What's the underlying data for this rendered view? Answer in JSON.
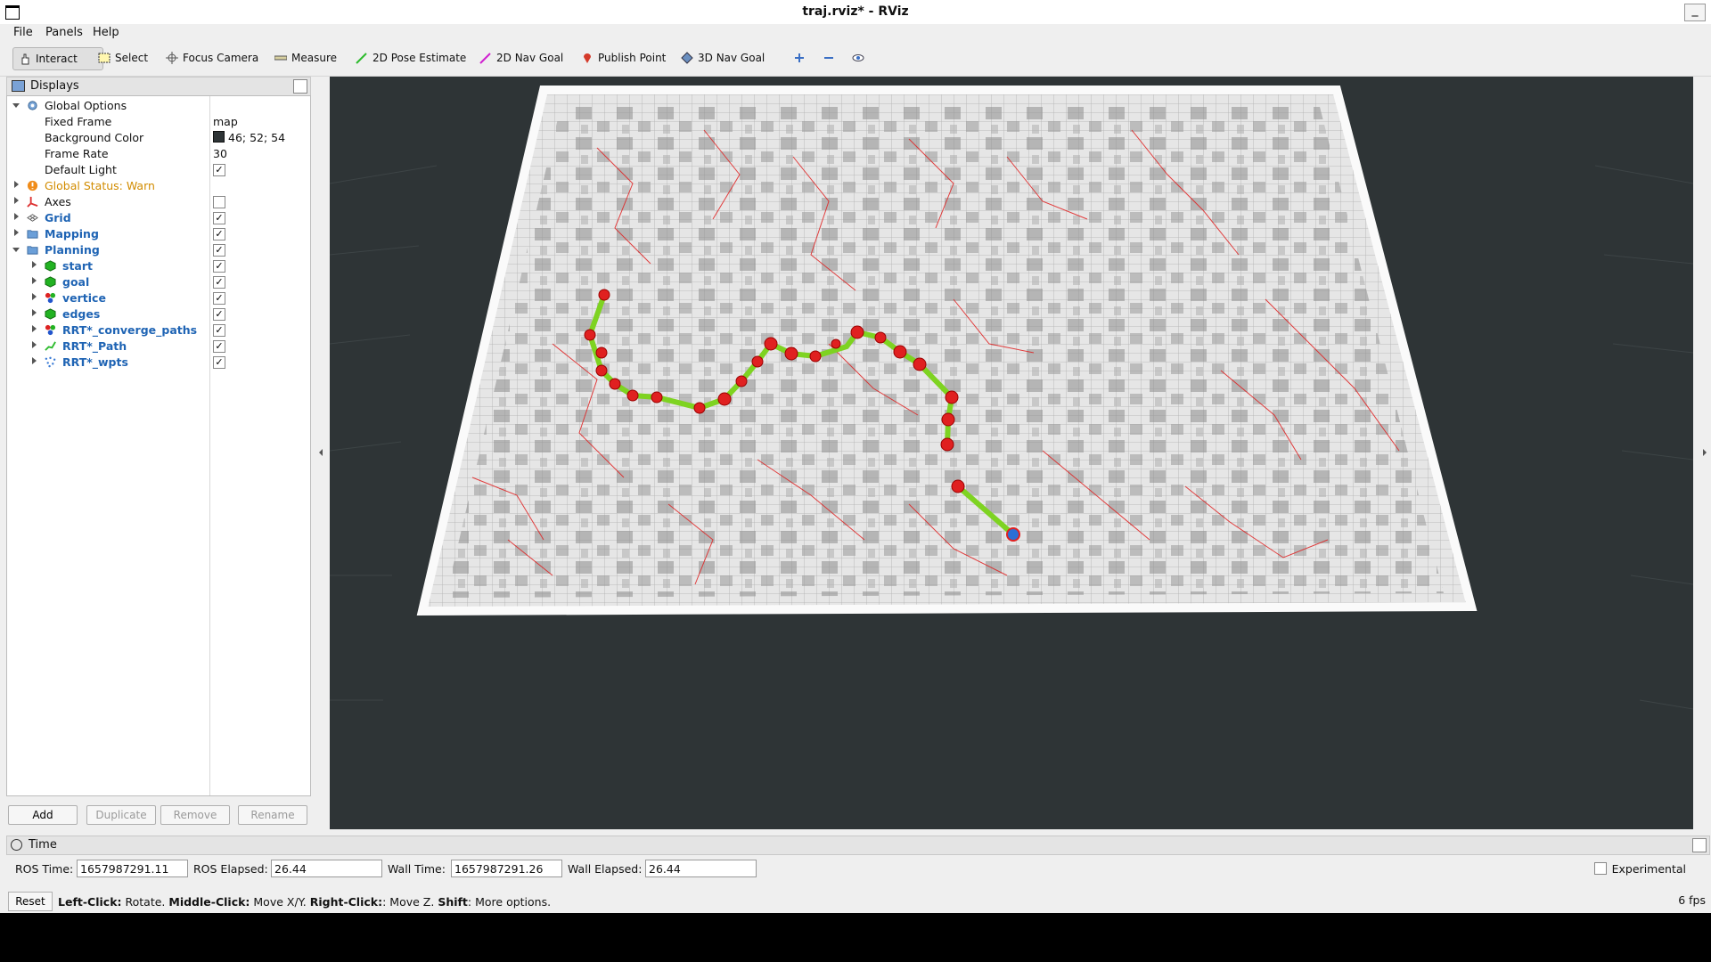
{
  "window": {
    "title": "traj.rviz* - RViz"
  },
  "menu": [
    "File",
    "Panels",
    "Help"
  ],
  "toolbar": {
    "interact": "Interact",
    "select": "Select",
    "focus_camera": "Focus Camera",
    "measure": "Measure",
    "pose_estimate": "2D Pose Estimate",
    "nav_goal": "2D Nav Goal",
    "publish_point": "Publish Point",
    "nav_goal_3d": "3D Nav Goal"
  },
  "displays": {
    "title": "Displays",
    "global_options": "Global Options",
    "fixed_frame_label": "Fixed Frame",
    "fixed_frame_value": "map",
    "bg_color_label": "Background Color",
    "bg_color_value": "46; 52; 54",
    "bg_color_hex": "#2e3436",
    "frame_rate_label": "Frame Rate",
    "frame_rate_value": "30",
    "default_light_label": "Default Light",
    "global_status": "Global Status: Warn",
    "axes": "Axes",
    "grid": "Grid",
    "mapping": "Mapping",
    "planning": "Planning",
    "start": "start",
    "goal": "goal",
    "vertice": "vertice",
    "edges": "edges",
    "converge": "RRT*_converge_paths",
    "path": "RRT*_Path",
    "wpts": "RRT*_wpts",
    "check": "✓"
  },
  "buttons": {
    "add": "Add",
    "duplicate": "Duplicate",
    "remove": "Remove",
    "rename": "Rename"
  },
  "time": {
    "title": "Time",
    "ros_time_label": "ROS Time:",
    "ros_time": "1657987291.11",
    "ros_elapsed_label": "ROS Elapsed:",
    "ros_elapsed": "26.44",
    "wall_time_label": "Wall Time:",
    "wall_time": "1657987291.26",
    "wall_elapsed_label": "Wall Elapsed:",
    "wall_elapsed": "26.44",
    "experimental": "Experimental"
  },
  "status": {
    "reset": "Reset",
    "hint_b1": "Left-Click:",
    "hint_t1": " Rotate. ",
    "hint_b2": "Middle-Click:",
    "hint_t2": " Move X/Y. ",
    "hint_b3": "Right-Click:",
    "hint_t3": ": Move Z. ",
    "hint_b4": "Shift",
    "hint_t4": ": More options.",
    "fps": "6 fps"
  },
  "scene": {
    "path_color": "#7ed321",
    "waypoint_color": "#e02020",
    "tree_color": "#e02020",
    "goal_color": "#2a6fd6"
  }
}
